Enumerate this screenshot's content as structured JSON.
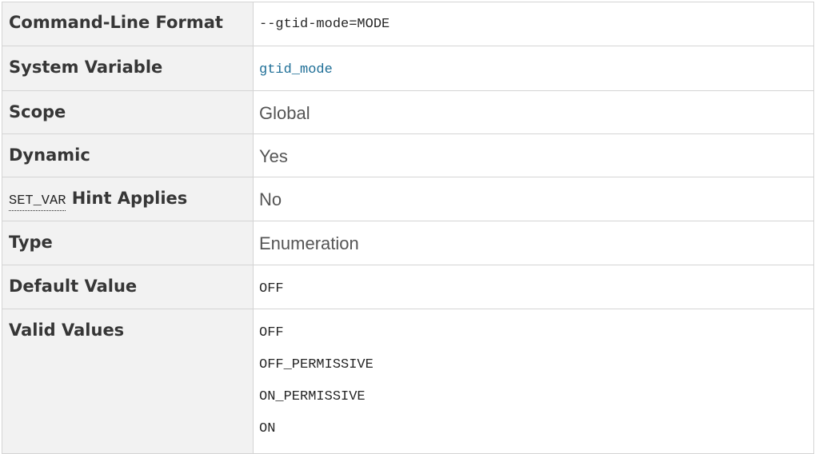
{
  "rows": {
    "command_line_format": {
      "label": "Command-Line Format",
      "value": "--gtid-mode=MODE"
    },
    "system_variable": {
      "label": "System Variable",
      "value": "gtid_mode"
    },
    "scope": {
      "label": "Scope",
      "value": "Global"
    },
    "dynamic": {
      "label": "Dynamic",
      "value": "Yes"
    },
    "set_var_hint": {
      "label_code": "SET_VAR",
      "label_text": " Hint Applies",
      "value": "No"
    },
    "type": {
      "label": "Type",
      "value": "Enumeration"
    },
    "default_value": {
      "label": "Default Value",
      "value": "OFF"
    },
    "valid_values": {
      "label": "Valid Values",
      "values": [
        "OFF",
        "OFF_PERMISSIVE",
        "ON_PERMISSIVE",
        "ON"
      ]
    }
  },
  "colors": {
    "label_bg": "#f2f2f2",
    "border": "#d4d4d4",
    "link": "#1f6f97"
  }
}
